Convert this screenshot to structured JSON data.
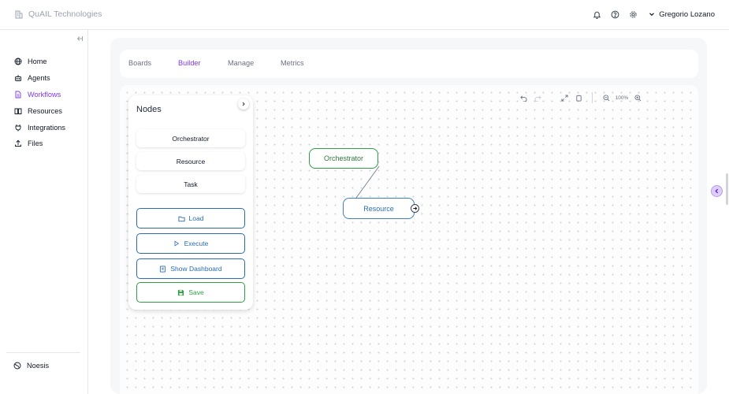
{
  "app": {
    "brand": "QuAIL Technologies",
    "user_name": "Gregorio Lozano"
  },
  "sidebar": {
    "items": [
      {
        "label": "Home",
        "icon": "globe-icon",
        "active": false
      },
      {
        "label": "Agents",
        "icon": "bot-icon",
        "active": false
      },
      {
        "label": "Workflows",
        "icon": "document-icon",
        "active": true
      },
      {
        "label": "Resources",
        "icon": "book-icon",
        "active": false
      },
      {
        "label": "Integrations",
        "icon": "plug-icon",
        "active": false
      },
      {
        "label": "Files",
        "icon": "upload-icon",
        "active": false
      }
    ],
    "footer": "Noesis"
  },
  "tabs": [
    {
      "label": "Boards",
      "active": false
    },
    {
      "label": "Builder",
      "active": true
    },
    {
      "label": "Manage",
      "active": false
    },
    {
      "label": "Metrics",
      "active": false
    }
  ],
  "toolbar": {
    "zoom": "100%"
  },
  "panel": {
    "title": "Nodes",
    "node_types": [
      "Orchestrator",
      "Resource",
      "Task"
    ],
    "actions": {
      "load": "Load",
      "execute": "Execute",
      "dashboard": "Show Dashboard",
      "save": "Save"
    }
  },
  "canvas": {
    "nodes": [
      "Orchestrator",
      "Resource"
    ]
  },
  "colors": {
    "accent": "#7c3aed",
    "blue": "#2b6cb0",
    "green": "#2f9e44"
  }
}
